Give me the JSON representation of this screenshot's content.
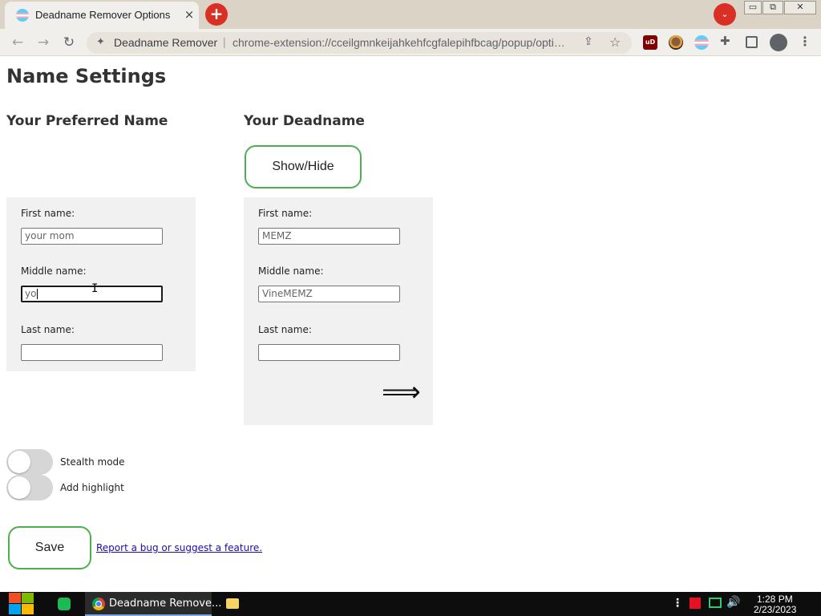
{
  "browser": {
    "tab_title": "Deadname Remover Options",
    "tab_close_icon": "×",
    "new_tab_icon": "+",
    "tab_search_icon": "⌄",
    "window_minimize": "▭",
    "window_maximize": "⧉",
    "window_close": "✕",
    "nav_back_icon": "←",
    "nav_forward_icon": "→",
    "reload_icon": "↻",
    "extension_icon": "✦",
    "extension_name": "Deadname Remover",
    "url_separator": "|",
    "url": "chrome-extension://cceilgmnkeijahkehfcgfalepihfbcag/popup/opti…",
    "share_icon": "⇪",
    "star_icon": "☆",
    "ublock_label": "uD",
    "puzzle_icon": "✚",
    "menu_icon": "⋮"
  },
  "page": {
    "title": "Name Settings",
    "preferred_heading": "Your Preferred Name",
    "deadname_heading": "Your Deadname",
    "show_hide_label": "Show/Hide",
    "preferred": {
      "first_label": "First name:",
      "first_placeholder": "your mom",
      "first_value": "",
      "middle_label": "Middle name:",
      "middle_value": "yo",
      "last_label": "Last name:",
      "last_value": ""
    },
    "deadname": {
      "first_label": "First name:",
      "first_value": "MEMZ",
      "middle_label": "Middle name:",
      "middle_value": "VineMEMZ",
      "last_label": "Last name:",
      "last_value": ""
    },
    "arrow_icon": "⟹",
    "stealth_label": "Stealth mode",
    "stealth_on": false,
    "highlight_label": "Add highlight",
    "highlight_on": false,
    "save_label": "Save",
    "report_link": "Report a bug or suggest a feature.",
    "accent_color": "#4caf50",
    "panel_color": "#f1f1f1"
  },
  "taskbar": {
    "chrome_label": "Deadname Remove...",
    "overflow_icon": "⋮",
    "volume_icon": "🔊",
    "time": "1:28 PM",
    "date": "2/23/2023"
  }
}
